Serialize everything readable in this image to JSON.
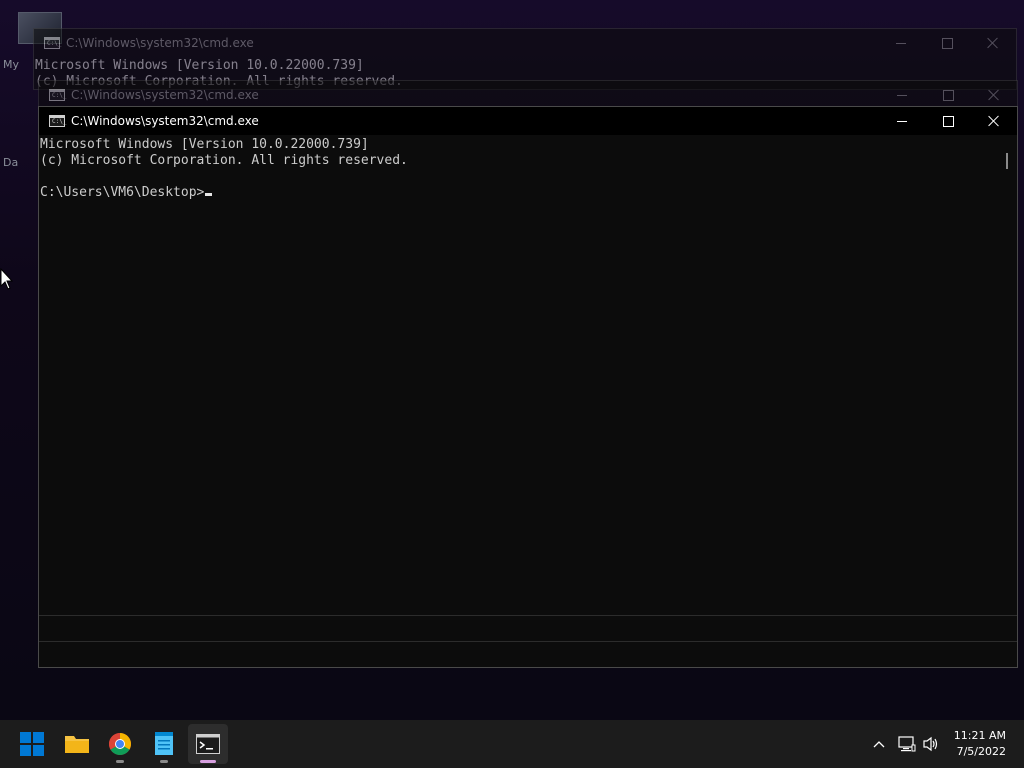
{
  "desktop": {
    "icon_labels": [
      "My",
      "Da"
    ]
  },
  "windows": [
    {
      "title": "C:\\Windows\\system32\\cmd.exe",
      "lines": [
        "Microsoft Windows [Version 10.0.22000.739]",
        "(c) Microsoft Corporation. All rights reserved."
      ]
    },
    {
      "title": "C:\\Windows\\system32\\cmd.exe"
    },
    {
      "title": "C:\\Windows\\system32\\cmd.exe",
      "lines": [
        "Microsoft Windows [Version 10.0.22000.739]",
        "(c) Microsoft Corporation. All rights reserved.",
        "",
        "C:\\Users\\VM6\\Desktop>"
      ]
    }
  ],
  "cmd_icon_text": "C:\\_",
  "taskbar": {
    "apps": [
      {
        "name": "start",
        "icon": "windows-logo-icon"
      },
      {
        "name": "file-explorer",
        "icon": "folder-icon"
      },
      {
        "name": "chrome",
        "icon": "chrome-icon"
      },
      {
        "name": "notepad",
        "icon": "notepad-icon"
      },
      {
        "name": "command-prompt",
        "icon": "terminal-icon"
      }
    ],
    "tray_icons": [
      "chevron-up-icon",
      "network-icon",
      "volume-icon"
    ],
    "clock": {
      "time": "11:21 AM",
      "date": "7/5/2022"
    }
  },
  "colors": {
    "windows_blue": "#0078d4",
    "folder_yellow": "#f6c342",
    "run_indicator": "#d7a0e0"
  }
}
